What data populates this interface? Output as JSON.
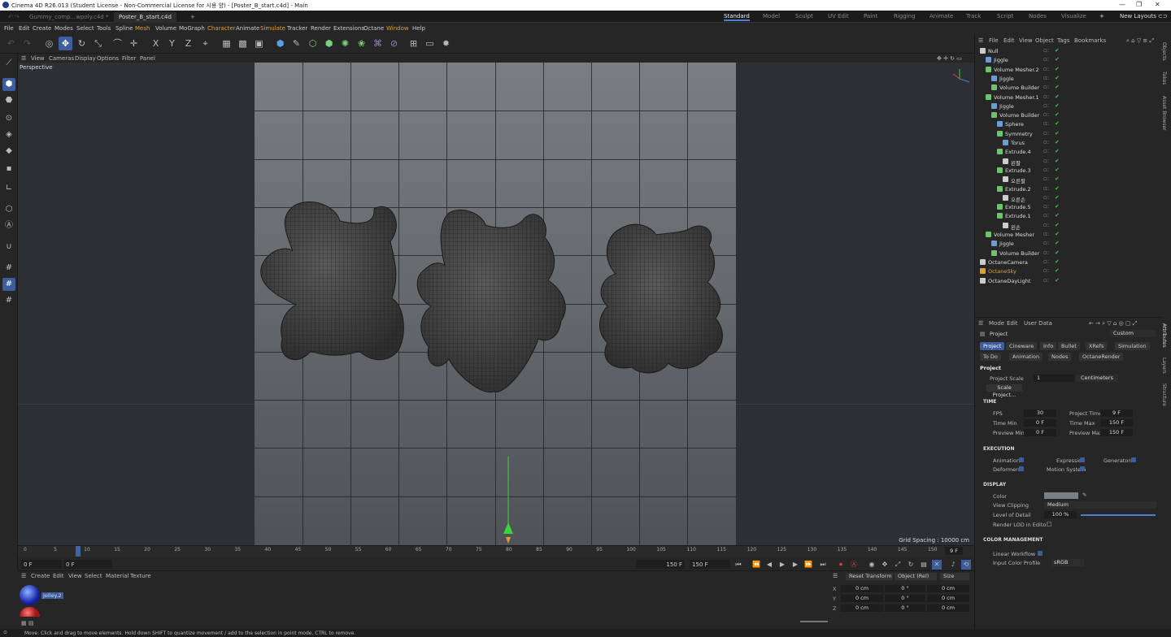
{
  "window": {
    "title": "Cinema 4D R26.013 (Student License - Non-Commercial License for 시용 양) - [Poster_B_start.c4d] - Main"
  },
  "doc_tabs": [
    "Gummy_comp...wpoly.c4d *",
    "Poster_B_start.c4d"
  ],
  "layouts": [
    "Standard",
    "Model",
    "Sculpt",
    "UV Edit",
    "Paint",
    "Rigging",
    "Animate",
    "Track",
    "Script",
    "Nodes",
    "Visualize"
  ],
  "new_layouts": "New Layouts",
  "menu": [
    "File",
    "Edit",
    "Create",
    "Modes",
    "Select",
    "Tools",
    "Spline",
    "Mesh",
    "Volume",
    "MoGraph",
    "Character",
    "Animate",
    "Simulate",
    "Tracker",
    "Render",
    "Extensions",
    "Octane",
    "Window",
    "Help"
  ],
  "viewport_menu": [
    "View",
    "Cameras",
    "Display",
    "Options",
    "Filter",
    "Panel"
  ],
  "viewport": {
    "label": "Perspective",
    "grid_spacing": "Grid Spacing : 10000 cm"
  },
  "timeline": {
    "ticks": [
      "0",
      "5",
      "10",
      "15",
      "20",
      "25",
      "30",
      "35",
      "40",
      "45",
      "50",
      "55",
      "60",
      "65",
      "70",
      "75",
      "80",
      "85",
      "90",
      "95",
      "100",
      "105",
      "110",
      "115",
      "120",
      "125",
      "130",
      "135",
      "140",
      "145",
      "150"
    ],
    "current_frame": 9,
    "current_frame_label": "9 F"
  },
  "playbar": {
    "start": "0 F",
    "start2": "0 F",
    "end": "150 F",
    "end2": "150 F"
  },
  "material_menu": [
    "Create",
    "Edit",
    "View",
    "Select",
    "Material",
    "Texture"
  ],
  "material": {
    "name": "Jelley.2"
  },
  "coords": {
    "menu": [
      "Reset Transform",
      "Object (Rel)",
      "Size"
    ],
    "rows": [
      {
        "axis": "X",
        "pos": "0 cm",
        "rot": "0 °",
        "size": "0 cm"
      },
      {
        "axis": "Y",
        "pos": "0 cm",
        "rot": "0 °",
        "size": "0 cm"
      },
      {
        "axis": "Z",
        "pos": "0 cm",
        "rot": "0 °",
        "size": "0 cm"
      }
    ]
  },
  "status": "Move: Click and drag to move elements. Hold down SHIFT to quantize movement / add to the selection in point mode, CTRL to remove.",
  "object_menu": [
    "File",
    "Edit",
    "View",
    "Object",
    "Tags",
    "Bookmarks"
  ],
  "objects": [
    {
      "name": "Null",
      "indent": 0,
      "color": "#cccccc"
    },
    {
      "name": "Jiggle",
      "indent": 1,
      "color": "#6a9cd6"
    },
    {
      "name": "Volume Mesher.2",
      "indent": 1,
      "color": "#6fc36f"
    },
    {
      "name": "Jiggle",
      "indent": 2,
      "color": "#6a9cd6"
    },
    {
      "name": "Volume Builder",
      "indent": 2,
      "color": "#6fc36f"
    },
    {
      "name": "Volume Mesher.1",
      "indent": 1,
      "color": "#6fc36f"
    },
    {
      "name": "Jiggle",
      "indent": 2,
      "color": "#6a9cd6"
    },
    {
      "name": "Volume Builder",
      "indent": 2,
      "color": "#6fc36f"
    },
    {
      "name": "Sphere",
      "indent": 3,
      "color": "#6a9cd6"
    },
    {
      "name": "Symmetry",
      "indent": 3,
      "color": "#6fc36f"
    },
    {
      "name": "Torus",
      "indent": 4,
      "color": "#6a9cd6"
    },
    {
      "name": "Extrude.4",
      "indent": 3,
      "color": "#6fc36f"
    },
    {
      "name": "왼팔",
      "indent": 4,
      "color": "#cccccc"
    },
    {
      "name": "Extrude.3",
      "indent": 3,
      "color": "#6fc36f"
    },
    {
      "name": "오른팔",
      "indent": 4,
      "color": "#cccccc"
    },
    {
      "name": "Extrude.2",
      "indent": 3,
      "color": "#6fc36f"
    },
    {
      "name": "오른손",
      "indent": 4,
      "color": "#cccccc"
    },
    {
      "name": "Extrude.5",
      "indent": 3,
      "color": "#6fc36f"
    },
    {
      "name": "Extrude.1",
      "indent": 3,
      "color": "#6fc36f"
    },
    {
      "name": "왼손",
      "indent": 4,
      "color": "#cccccc"
    },
    {
      "name": "Volume Mesher",
      "indent": 1,
      "color": "#6fc36f"
    },
    {
      "name": "Jiggle",
      "indent": 2,
      "color": "#6a9cd6"
    },
    {
      "name": "Volume Builder",
      "indent": 2,
      "color": "#6fc36f"
    },
    {
      "name": "OctaneCamera",
      "indent": 0,
      "color": "#cccccc"
    },
    {
      "name": "OctaneSky",
      "indent": 0,
      "color": "#e0a030",
      "highlight": true
    },
    {
      "name": "OctaneDayLight",
      "indent": 0,
      "color": "#cccccc"
    }
  ],
  "attr_menu": [
    "Mode",
    "Edit",
    "User Data"
  ],
  "attr": {
    "header": "Project",
    "preset": "Custom",
    "tabs_row1": [
      "Project",
      "Cineware",
      "Info",
      "Bullet",
      "XRefs",
      "Simulation"
    ],
    "tabs_row2": [
      "To Do",
      "Animation",
      "Nodes",
      "OctaneRender"
    ],
    "section": "Project",
    "project_scale_label": "Project Scale",
    "project_scale_value": "1",
    "project_scale_unit": "Centimeters",
    "scale_button": "Scale Project...",
    "time_section": "TIME",
    "fps_label": "FPS",
    "fps": "30",
    "project_time_label": "Project Time",
    "project_time": "9 F",
    "time_min_label": "Time Min",
    "time_min": "0 F",
    "time_max_label": "Time Max",
    "time_max": "150 F",
    "preview_min_label": "Preview Min",
    "preview_min": "0 F",
    "preview_max_label": "Preview Max",
    "preview_max": "150 F",
    "exec_section": "EXECUTION",
    "animation_label": "Animation",
    "expression_label": "Expression",
    "generators_label": "Generators",
    "deformers_label": "Deformers",
    "motion_label": "Motion System",
    "display_section": "DISPLAY",
    "color_label": "Color",
    "view_clipping_label": "View Clipping",
    "view_clipping": "Medium",
    "lod_label": "Level of Detail",
    "lod": "100 %",
    "lod_fraction": 1.0,
    "render_lod_label": "Render LOD in Editor",
    "cm_section": "COLOR MANAGEMENT",
    "linear_label": "Linear Workflow",
    "icp_label": "Input Color Profile",
    "icp": "sRGB"
  },
  "side_tabs": [
    "Objects",
    "Takes",
    "Asset Browser",
    "Attributes",
    "Layers",
    "Structure"
  ]
}
